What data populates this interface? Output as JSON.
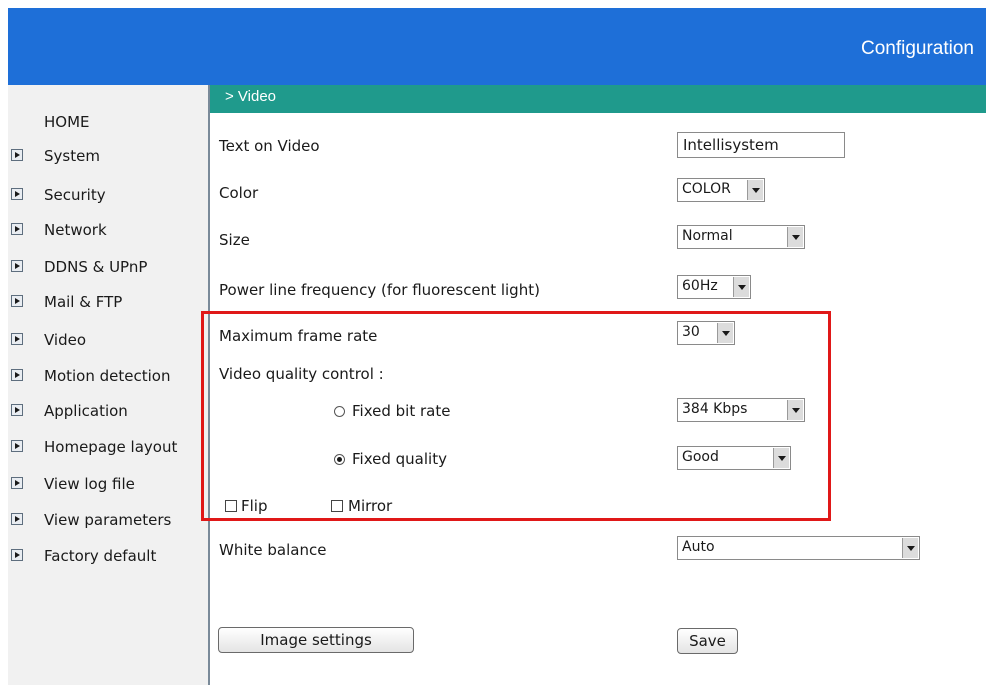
{
  "header": {
    "title": "Configuration"
  },
  "colors": {
    "header_bg": "#1e6fd8",
    "section_bg": "#1f9a8c",
    "highlight": "#e01818"
  },
  "sidebar": {
    "home": "HOME",
    "items": [
      {
        "label": "System",
        "icon": "arrow-right-icon"
      },
      {
        "label": "Security",
        "icon": "arrow-right-icon"
      },
      {
        "label": "Network",
        "icon": "arrow-right-icon"
      },
      {
        "label": "DDNS & UPnP",
        "icon": "arrow-right-icon"
      },
      {
        "label": "Mail & FTP",
        "icon": "arrow-right-icon"
      },
      {
        "label": "Video",
        "icon": "arrow-right-icon"
      },
      {
        "label": "Motion detection",
        "icon": "arrow-right-icon"
      },
      {
        "label": "Application",
        "icon": "arrow-right-icon"
      },
      {
        "label": "Homepage layout",
        "icon": "arrow-right-icon"
      },
      {
        "label": "View log file",
        "icon": "arrow-right-icon"
      },
      {
        "label": "View parameters",
        "icon": "arrow-right-icon"
      },
      {
        "label": "Factory default",
        "icon": "arrow-right-icon"
      }
    ]
  },
  "section": {
    "title": "> Video"
  },
  "form": {
    "text_on_video": {
      "label": "Text on Video",
      "value": "Intellisystem"
    },
    "color": {
      "label": "Color",
      "value": "COLOR"
    },
    "size": {
      "label": "Size",
      "value": "Normal"
    },
    "power_line": {
      "label": "Power line frequency (for fluorescent light)",
      "value": "60Hz"
    },
    "max_frame_rate": {
      "label": "Maximum frame rate",
      "value": "30"
    },
    "quality_control": {
      "label": "Video quality control :"
    },
    "fixed_bit_rate": {
      "label": "Fixed bit rate",
      "value": "384 Kbps",
      "selected": false
    },
    "fixed_quality": {
      "label": "Fixed quality",
      "value": "Good",
      "selected": true
    },
    "flip": {
      "label": "Flip",
      "checked": false
    },
    "mirror": {
      "label": "Mirror",
      "checked": false
    },
    "white_balance": {
      "label": "White balance",
      "value": "Auto"
    }
  },
  "buttons": {
    "image_settings": "Image settings",
    "save": "Save"
  }
}
